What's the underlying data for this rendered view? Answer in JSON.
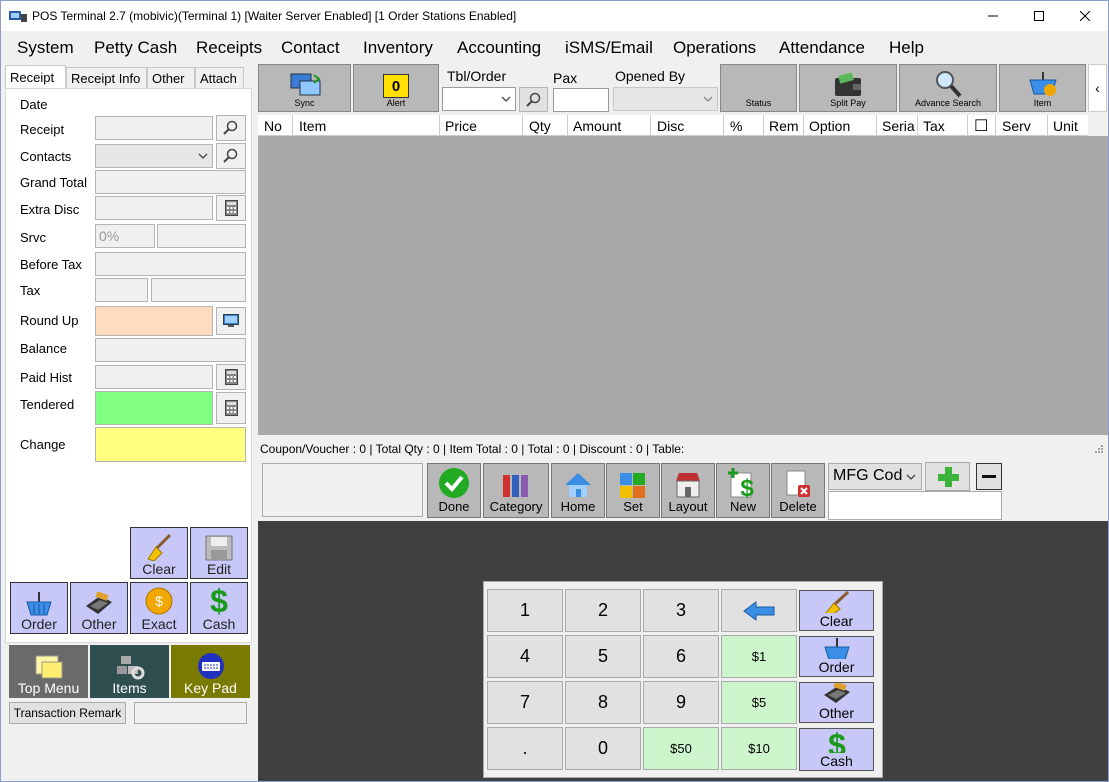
{
  "window": {
    "title": "POS Terminal 2.7 (mobivic)(Terminal 1) [Waiter Server Enabled] [1 Order Stations Enabled]"
  },
  "menu": [
    "System",
    "Petty Cash",
    "Receipts",
    "Contact",
    "Inventory",
    "Accounting",
    "iSMS/Email",
    "Operations",
    "Attendance",
    "Help"
  ],
  "left_tabs": [
    "Receipt",
    "Receipt Info",
    "Other",
    "Attach"
  ],
  "fields": {
    "date": "Date",
    "receipt": "Receipt",
    "contacts": "Contacts",
    "grand_total": "Grand Total",
    "extra_disc": "Extra Disc",
    "srvc": "Srvc",
    "srvc_placeholder": "0%",
    "before_tax": "Before Tax",
    "tax": "Tax",
    "round_up": "Round Up",
    "balance": "Balance",
    "paid_hist": "Paid Hist",
    "tendered": "Tendered",
    "change": "Change"
  },
  "panel_buttons": {
    "clear": "Clear",
    "edit": "Edit",
    "order": "Order",
    "other": "Other",
    "exact": "Exact",
    "cash": "Cash"
  },
  "bottom_left": {
    "top_menu": "Top Menu",
    "items": "Items",
    "key_pad": "Key Pad",
    "transaction_remark": "Transaction Remark"
  },
  "toolbar": {
    "sync": "Sync",
    "alert": "Alert",
    "alert_count": "0",
    "tbl_order": "Tbl/Order",
    "pax": "Pax",
    "opened_by": "Opened By",
    "status": "Status",
    "split_pay": "Split Pay",
    "advance_search": "Advance Search",
    "item": "Item",
    "collapse": "‹"
  },
  "grid_columns": [
    "No",
    "Item",
    "Price",
    "Qty",
    "Amount",
    "Disc",
    "%",
    "Rem",
    "Option",
    "Seria",
    "Tax",
    "☐",
    "Serv",
    "Unit"
  ],
  "status_line": "Coupon/Voucher :  0 | Total Qty :  0 | Item Total :  0 | Total :  0 | Discount :  0 | Table:",
  "action_buttons": [
    "Done",
    "Category",
    "Home",
    "Set",
    "Layout",
    "New",
    "Delete"
  ],
  "mfg": {
    "selected": "MFG Cod"
  },
  "keypad": {
    "keys": [
      "1",
      "2",
      "3",
      "4",
      "5",
      "6",
      "7",
      "8",
      "9",
      ".",
      "0"
    ],
    "money": [
      "$1",
      "$5",
      "$10",
      "$50"
    ],
    "fn": [
      "Clear",
      "Order",
      "Other",
      "Cash"
    ]
  },
  "colors": {
    "round_up": "#ffdcc0",
    "tendered": "#80ff80",
    "change": "#ffff80",
    "panel_button": "#c8c8f8",
    "grid_bg": "#a9a9a9",
    "dark_area": "#404040"
  }
}
